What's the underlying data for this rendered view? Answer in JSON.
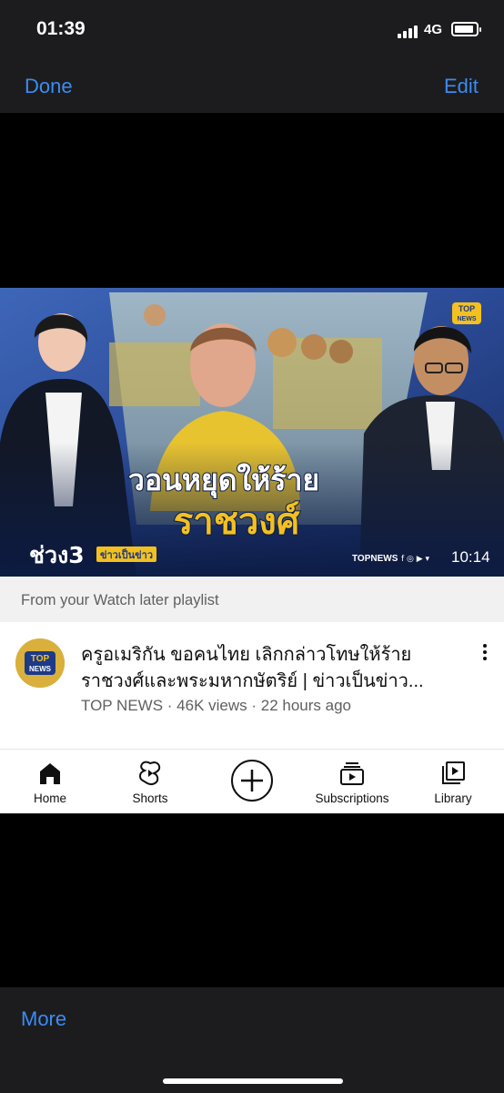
{
  "status_bar": {
    "time": "01:39",
    "network": "4G",
    "battery_level": 0.9
  },
  "nav": {
    "done_label": "Done",
    "edit_label": "Edit"
  },
  "thumbnail": {
    "headline_line1": "วอนหยุดให้ร้าย",
    "headline_line2": "ราชวงศ์",
    "segment_label": "ช่วง3",
    "segment_tag": "ข่าวเป็นข่าว",
    "brand_top": "TOP",
    "brand_news": "NEWS",
    "footer_brand": "TOPNEWS",
    "duration": "10:14"
  },
  "card": {
    "playlist_label": "From your Watch later playlist",
    "avatar_top": "TOP",
    "avatar_news": "NEWS",
    "title_line1": "ครูอเมริกัน ขอคนไทย เลิกกล่าวโทษให้ร้าย",
    "title_line2": "ราชวงศ์และพระมหากษัตริย์ | ข่าวเป็นข่าว...",
    "meta": "TOP NEWS · 46K views · 22 hours ago"
  },
  "tabs": [
    {
      "label": "Home",
      "icon": "home-icon"
    },
    {
      "label": "Shorts",
      "icon": "shorts-icon"
    },
    {
      "label": "",
      "icon": "create-icon"
    },
    {
      "label": "Subscriptions",
      "icon": "subscriptions-icon"
    },
    {
      "label": "Library",
      "icon": "library-icon"
    }
  ],
  "bottom": {
    "more_label": "More"
  },
  "colors": {
    "ios_blue": "#3b8cf2",
    "headline_yellow": "#f3c020",
    "bar_dark": "#1c1c1e"
  }
}
